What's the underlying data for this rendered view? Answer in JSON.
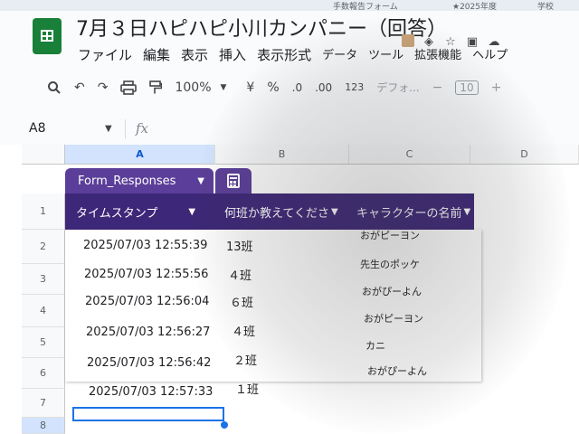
{
  "browser": {
    "bookmark1": "手数報告フォーム",
    "bookmark2": "★2025年度",
    "bookmark3": "学校"
  },
  "app": {
    "logo_icon": "sheets-logo-icon",
    "title": "7月３日ハピハピ小川カンパニー（回答）"
  },
  "menu": [
    "ファイル",
    "編集",
    "表示",
    "挿入",
    "表示形式",
    "データ",
    "ツール",
    "拡張機能",
    "ヘルプ"
  ],
  "toolbar": {
    "zoom": "100%",
    "currency": "¥",
    "percent": "%",
    "dec_decrease": ".0",
    "dec_increase": ".00",
    "number_format": "123",
    "font": "デフォ...",
    "minus": "−",
    "font_size": "10",
    "plus": "+"
  },
  "formula_bar": {
    "cell_ref": "A8",
    "fx": "fx"
  },
  "columns": [
    "A",
    "B",
    "C",
    "D"
  ],
  "rows": [
    "1",
    "2",
    "3",
    "4",
    "5",
    "6",
    "7",
    "8"
  ],
  "table": {
    "name": "Form_Responses",
    "headers": [
      "タイムスタンプ",
      "何班か教えてくださ",
      "キャラクターの名前"
    ],
    "rows": [
      {
        "timestamp": "2025/07/03 12:55:39",
        "group": "13班",
        "character": "おがピーヨン"
      },
      {
        "timestamp": "2025/07/03 12:55:56",
        "group": "４班",
        "character": "先生のポッケ"
      },
      {
        "timestamp": "2025/07/03 12:56:04",
        "group": "６班",
        "character": "おがぴーよん"
      },
      {
        "timestamp": "2025/07/03 12:56:27",
        "group": "４班",
        "character": "おがピーヨン"
      },
      {
        "timestamp": "2025/07/03 12:56:42",
        "group": "２班",
        "character": "カニ"
      },
      {
        "timestamp": "2025/07/03 12:57:33",
        "group": "１班",
        "character": "おがぴーよん"
      }
    ]
  },
  "colors": {
    "table_header": "#3d2778",
    "table_tab": "#5b3e99",
    "selection": "#1a73e8",
    "logo": "#188038"
  }
}
